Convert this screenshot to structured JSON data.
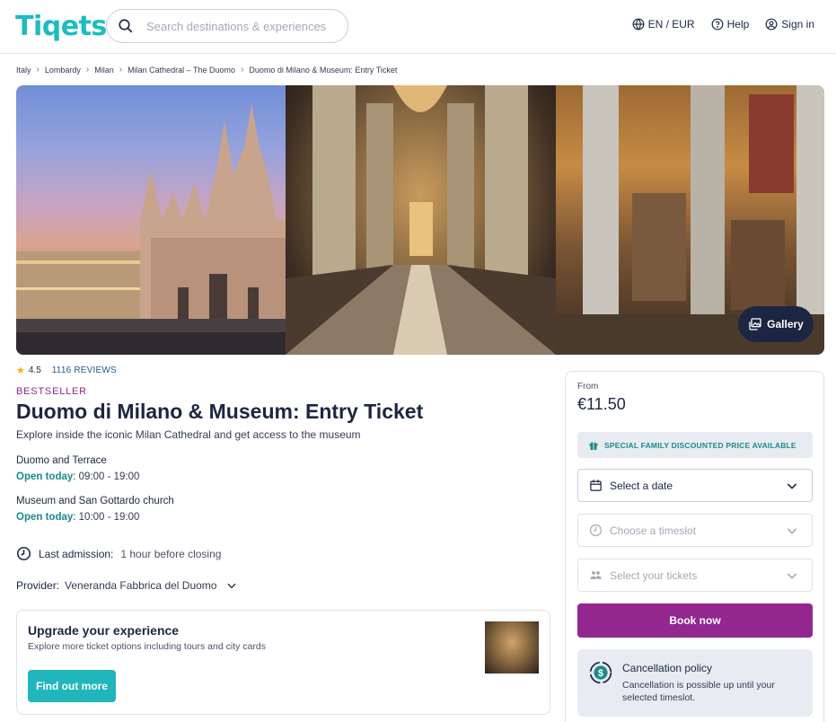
{
  "header": {
    "logo": "Tiqets",
    "search_placeholder": "Search destinations & experiences",
    "language_currency": "EN / EUR",
    "help": "Help",
    "sign_in": "Sign in"
  },
  "breadcrumb": [
    "Italy",
    "Lombardy",
    "Milan",
    "Milan Cathedral – The Duomo",
    "Duomo di Milano & Museum: Entry Ticket"
  ],
  "gallery": {
    "button_label": "Gallery"
  },
  "product": {
    "rating": "4.5",
    "reviews": "1116 REVIEWS",
    "badge": "BESTSELLER",
    "title": "Duomo di Milano & Museum: Entry Ticket",
    "subtitle": "Explore inside the iconic Milan Cathedral and get access to the museum",
    "schedules": [
      {
        "name": "Duomo and Terrace",
        "open_label": "Open today",
        "hours": ": 09:00 - 19:00"
      },
      {
        "name": "Museum and San Gottardo church",
        "open_label": "Open today",
        "hours": ": 10:00 - 19:00"
      }
    ],
    "last_admission_label": "Last admission:",
    "last_admission_value": "1 hour before closing",
    "provider_label": "Provider:",
    "provider_value": "Veneranda Fabbrica del Duomo"
  },
  "upgrade": {
    "title": "Upgrade your experience",
    "text": "Explore more ticket options including tours and city cards",
    "button": "Find out more"
  },
  "booking": {
    "from_label": "From",
    "price": "€11.50",
    "promo": "SPECIAL FAMILY DISCOUNTED PRICE AVAILABLE",
    "date_select": "Select a date",
    "timeslot_select": "Choose a timeslot",
    "tickets_select": "Select your tickets",
    "book_button": "Book now",
    "cancellation_title": "Cancellation policy",
    "cancellation_text": "Cancellation is possible up until your selected timeslot."
  },
  "colors": {
    "brand_teal": "#1dbcc1",
    "brand_purple": "#93278f",
    "navy": "#1c2642"
  }
}
